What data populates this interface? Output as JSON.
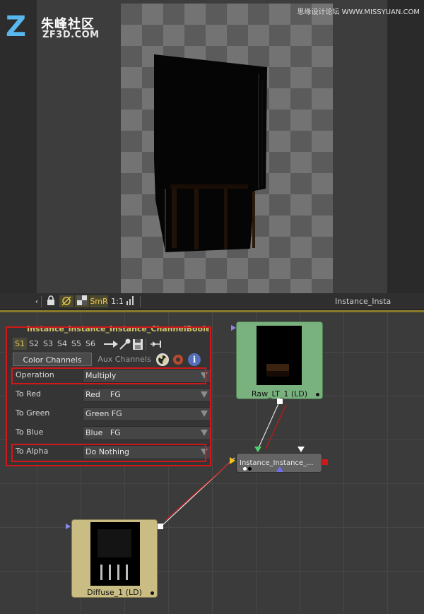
{
  "branding": {
    "logo_mark": "Z",
    "logo_cn": "朱峰社区",
    "logo_en": "ZF3D.COM",
    "watermark": "思缘设计论坛 WWW.MISSYUAN.COM"
  },
  "viewer_toolbar": {
    "smr": "SmR",
    "ratio": "1:1",
    "view_name": "Instance_Insta"
  },
  "panel": {
    "title": "Instance_Instance_Instance_ChannelBoolea",
    "sections": [
      "S1",
      "S2",
      "S3",
      "S4",
      "S5",
      "S6"
    ],
    "active_section": "S1",
    "tabs": [
      "Color Channels",
      "Aux Channels"
    ],
    "active_tab": "Color Channels",
    "rows": [
      {
        "label": "Operation",
        "value": "Multiply"
      },
      {
        "label": "To Red",
        "value": "Red    FG"
      },
      {
        "label": "To Green",
        "value": "Green FG"
      },
      {
        "label": "To Blue",
        "value": "Blue   FG"
      },
      {
        "label": "To Alpha",
        "value": "Do Nothing"
      }
    ]
  },
  "nodes": {
    "raw": {
      "label": "Raw_LT_1  (LD)"
    },
    "instance": {
      "label": "Instance_Instance_..."
    },
    "diffuse": {
      "label": "Diffuse_1  (LD)"
    }
  },
  "colors": {
    "highlight_red": "#d0181a",
    "raw_node": "#7ab27f",
    "diffuse_node": "#c9bd84",
    "instance_node": "#646464",
    "accent_gold": "#d6c36a"
  }
}
